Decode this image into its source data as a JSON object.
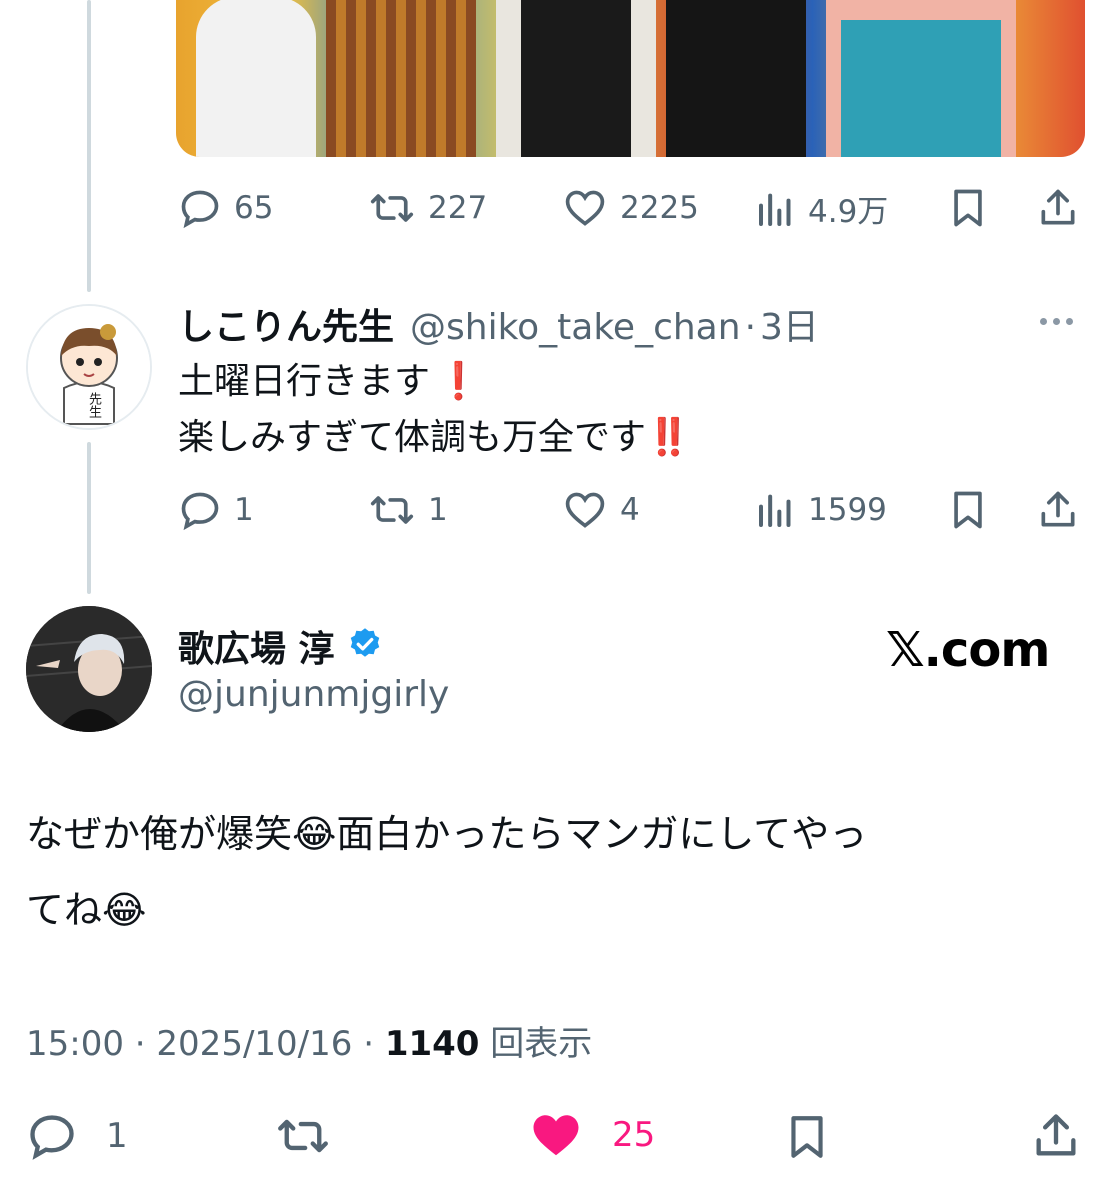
{
  "top_tweet": {
    "actions": {
      "replies": "65",
      "retweets": "227",
      "likes": "2225",
      "views": "4.9万"
    }
  },
  "reply": {
    "name": "しこりん先生",
    "handle": "@shiko_take_chan",
    "separator": "·",
    "time": "3日",
    "text_line1": "土曜日行きます",
    "text_line1_emoji": "❗",
    "text_line2": "楽しみすぎて体調も万全です",
    "text_line2_emoji": "‼️",
    "avatar_shirt_text": "先生",
    "actions": {
      "replies": "1",
      "retweets": "1",
      "likes": "4",
      "views": "1599"
    }
  },
  "main_tweet": {
    "name": "歌広場 淳",
    "handle": "@junjunmjgirly",
    "brand": "𝕏.com",
    "text_line1": "なぜか俺が爆笑😂面白かったらマンガにしてやっ",
    "text_line2": "てね😂",
    "time": "15:00",
    "date": "2025/10/16",
    "views_count": "1140",
    "views_label": "回表示",
    "dot": "·",
    "actions": {
      "replies": "1",
      "likes": "25"
    }
  },
  "colors": {
    "like_active": "#f91880",
    "verified": "#1d9bf0",
    "muted": "#536471"
  }
}
